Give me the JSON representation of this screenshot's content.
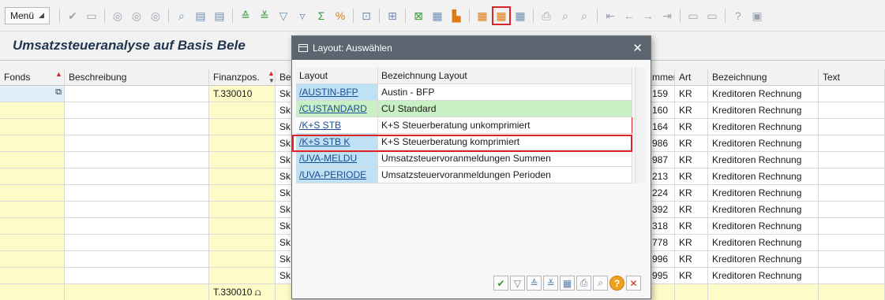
{
  "toolbar": {
    "menu_label": "Menü",
    "icons": [
      "check-icon",
      "save-icon",
      "back-icon",
      "exit-icon",
      "cancel-icon",
      "find-icon",
      "find-next-icon",
      "detail-icon",
      "sort-asc-icon",
      "sort-desc-icon",
      "filter-icon",
      "filter-set-icon",
      "sum-icon",
      "subtotal-icon",
      "print-preview-icon",
      "export-icon",
      "spreadsheet-icon",
      "word-icon",
      "abc-icon",
      "layout-change-icon",
      "layout-select-icon",
      "layout-save-icon",
      "print-icon",
      "find-icon-2",
      "find-next-icon-2",
      "first-page-icon",
      "prev-page-icon",
      "next-page-icon",
      "last-page-icon",
      "new-session-icon",
      "shortcut-icon",
      "help-icon",
      "monitor-icon"
    ]
  },
  "page": {
    "title": "Umsatzsteueranalyse auf Basis Bele"
  },
  "grid": {
    "headers": {
      "fonds": "Fonds",
      "beschreibung": "Beschreibung",
      "finanzpos": "Finanzpos.",
      "be": "Be",
      "nummer": "mmer",
      "art": "Art",
      "bezeichnung": "Bezeichnung",
      "text": "Text"
    },
    "rows": [
      {
        "finanzpos": "T.330010",
        "be": "Sk",
        "nummer": "159",
        "art": "KR",
        "bezeichnung": "Kreditoren Rechnung"
      },
      {
        "finanzpos": "",
        "be": "Sk",
        "nummer": "160",
        "art": "KR",
        "bezeichnung": "Kreditoren Rechnung"
      },
      {
        "finanzpos": "",
        "be": "Sk",
        "nummer": "164",
        "art": "KR",
        "bezeichnung": "Kreditoren Rechnung"
      },
      {
        "finanzpos": "",
        "be": "Sk",
        "nummer": "986",
        "art": "KR",
        "bezeichnung": "Kreditoren Rechnung"
      },
      {
        "finanzpos": "",
        "be": "Sk",
        "nummer": "987",
        "art": "KR",
        "bezeichnung": "Kreditoren Rechnung"
      },
      {
        "finanzpos": "",
        "be": "Sk",
        "nummer": "213",
        "art": "KR",
        "bezeichnung": "Kreditoren Rechnung"
      },
      {
        "finanzpos": "",
        "be": "Sk",
        "nummer": "224",
        "art": "KR",
        "bezeichnung": "Kreditoren Rechnung"
      },
      {
        "finanzpos": "",
        "be": "Sk",
        "nummer": "392",
        "art": "KR",
        "bezeichnung": "Kreditoren Rechnung"
      },
      {
        "finanzpos": "",
        "be": "Sk",
        "nummer": "318",
        "art": "KR",
        "bezeichnung": "Kreditoren Rechnung"
      },
      {
        "finanzpos": "",
        "be": "Sk",
        "nummer": "778",
        "art": "KR",
        "bezeichnung": "Kreditoren Rechnung"
      },
      {
        "finanzpos": "",
        "be": "Sk",
        "nummer": "996",
        "art": "KR",
        "bezeichnung": "Kreditoren Rechnung"
      },
      {
        "finanzpos": "",
        "be": "Sk",
        "nummer": "995",
        "art": "KR",
        "bezeichnung": "Kreditoren Rechnung"
      }
    ],
    "total_finanzpos": "T.330010"
  },
  "dialog": {
    "title": "Layout: Auswählen",
    "col_layout": "Layout",
    "col_bezeichnung": "Bezeichnung Layout",
    "rows": [
      {
        "layout": "/AUSTIN-BFP",
        "bezeichnung": "Austin - BFP",
        "color": "blue"
      },
      {
        "layout": "/CUSTANDARD",
        "bezeichnung": "CU Standard",
        "color": "green"
      },
      {
        "layout": "/K+S STB",
        "bezeichnung": "K+S Steuerberatung unkomprimiert",
        "color": "white"
      },
      {
        "layout": "/K+S STB K",
        "bezeichnung": "K+S Steuerberatung komprimiert",
        "color": "blue"
      },
      {
        "layout": "/UVA-MELDU",
        "bezeichnung": "Umsatzsteuervoranmeldungen Summen",
        "color": "blue"
      },
      {
        "layout": "/UVA-PERIODE",
        "bezeichnung": "Umsatzsteuervoranmeldungen Perioden",
        "color": "blue"
      }
    ],
    "footer_buttons": [
      "ok-icon",
      "filter-icon",
      "sort-asc-icon",
      "sort-desc-icon",
      "layout-icon",
      "print-icon",
      "find-icon",
      "help-icon",
      "cancel-icon"
    ]
  },
  "colors": {
    "accent_red": "#d9252a",
    "yellow_cell": "#fdfbc8",
    "link_blue": "#1a4c93",
    "highlight_blue": "#bfe1f5",
    "highlight_green": "#c9f0c4"
  }
}
